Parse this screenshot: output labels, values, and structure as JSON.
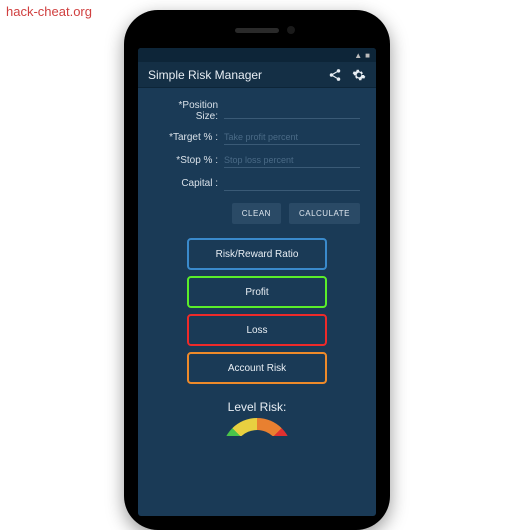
{
  "watermark": "hack-cheat.org",
  "app": {
    "title": "Simple Risk Manager"
  },
  "form": {
    "position_label": "*Position Size:",
    "position_placeholder": "",
    "target_label": "*Target % :",
    "target_placeholder": "Take profit percent",
    "stop_label": "*Stop % :",
    "stop_placeholder": "Stop loss percent",
    "capital_label": "Capital :",
    "capital_placeholder": ""
  },
  "buttons": {
    "clean": "CLEAN",
    "calculate": "CALCULATE"
  },
  "results": {
    "risk_reward": "Risk/Reward Ratio",
    "profit": "Profit",
    "loss": "Loss",
    "account_risk": "Account Risk"
  },
  "level_risk": {
    "label": "Level Risk:"
  }
}
